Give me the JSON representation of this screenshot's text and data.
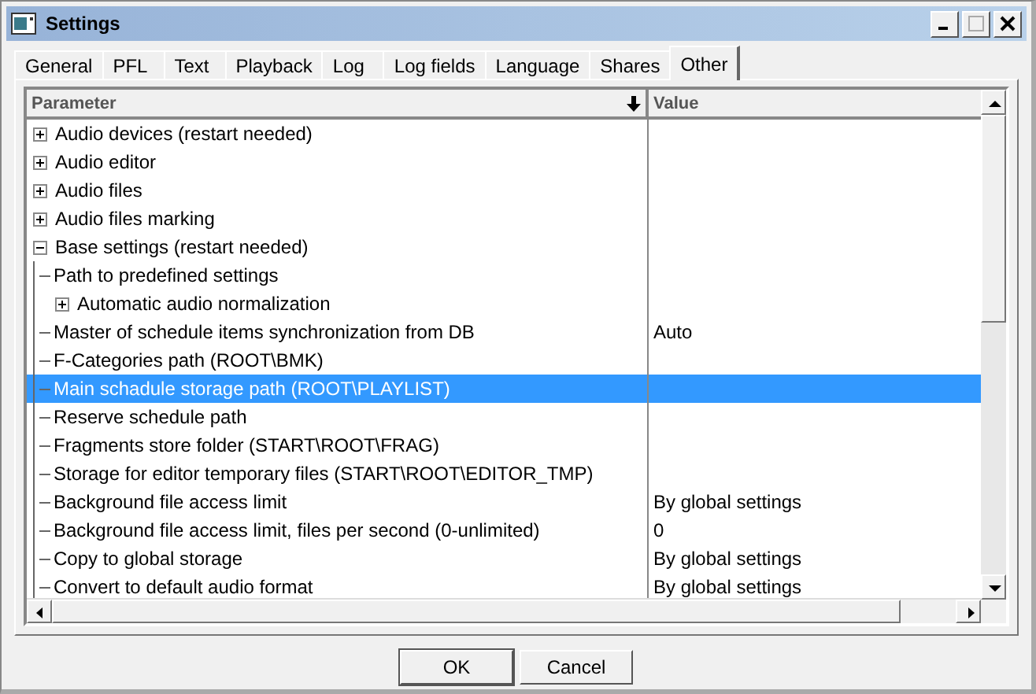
{
  "window": {
    "title": "Settings"
  },
  "tabs": [
    {
      "label": "General",
      "selected": false
    },
    {
      "label": "PFL",
      "selected": false
    },
    {
      "label": "Text",
      "selected": false
    },
    {
      "label": "Playback",
      "selected": false
    },
    {
      "label": "Log",
      "selected": false
    },
    {
      "label": "Log fields",
      "selected": false
    },
    {
      "label": "Language",
      "selected": false
    },
    {
      "label": "Shares",
      "selected": false
    },
    {
      "label": "Other",
      "selected": true
    }
  ],
  "table": {
    "columns": [
      "Parameter",
      "Value"
    ],
    "rows": [
      {
        "label": "Audio devices (restart needed)",
        "expanded": false,
        "selected": false
      },
      {
        "label": "Audio editor",
        "expanded": false,
        "selected": false
      },
      {
        "label": "Audio files",
        "expanded": false,
        "selected": false
      },
      {
        "label": "Audio files marking",
        "expanded": false,
        "selected": false
      },
      {
        "label": "Base settings (restart needed)",
        "expanded": true,
        "selected": false,
        "children": [
          {
            "label": "Path to predefined settings",
            "selected": false
          },
          {
            "label": "Automatic audio normalization",
            "expanded": false,
            "selected": false
          },
          {
            "label": "Master of schedule items synchronization from DB",
            "value": "Auto",
            "selected": false
          },
          {
            "label": "F-Categories path (ROOT\\BMK)",
            "selected": false
          },
          {
            "label": "Main schadule storage path (ROOT\\PLAYLIST)",
            "selected": true
          },
          {
            "label": "Reserve schedule path",
            "selected": false
          },
          {
            "label": "Fragments store folder (START\\ROOT\\FRAG)",
            "selected": false
          },
          {
            "label": "Storage for editor temporary files (START\\ROOT\\EDITOR_TMP)",
            "selected": false
          },
          {
            "label": "Background file access limit",
            "value": "By global settings",
            "selected": false
          },
          {
            "label": "Background file access limit, files per second (0-unlimited)",
            "value": "0",
            "selected": false
          },
          {
            "label": "Copy to global storage",
            "value": "By global settings",
            "selected": false
          },
          {
            "label": "Convert to default audio format",
            "value": "By global settings",
            "selected": false
          }
        ]
      }
    ]
  },
  "buttons": [
    "OK",
    "Cancel"
  ]
}
